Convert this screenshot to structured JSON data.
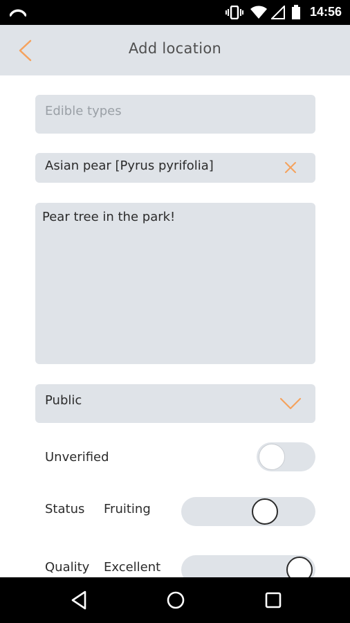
{
  "status_bar": {
    "time": "14:56"
  },
  "app_bar": {
    "title": "Add location"
  },
  "form": {
    "edible_types_placeholder": "Edible types",
    "selected_type": "Asian pear [Pyrus pyrifolia]",
    "notes": "Pear tree in the park!",
    "visibility": "Public",
    "verified_label": "Unverified",
    "verified_on": false,
    "status_label": "Status",
    "status_value": "Fruiting",
    "quality_label": "Quality",
    "quality_value": "Excellent"
  },
  "colors": {
    "accent": "#f5a25d",
    "field_bg": "#dfe3e8"
  },
  "icons": {
    "back": "chevron-left-icon",
    "remove": "close-icon",
    "dropdown": "chevron-down-icon",
    "nav_back": "triangle-back-icon",
    "nav_home": "circle-home-icon",
    "nav_recents": "square-recents-icon"
  }
}
